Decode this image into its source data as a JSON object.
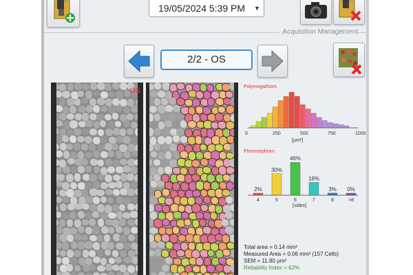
{
  "header": {
    "datetime": "19/05/2024 5:39 PM"
  },
  "section": {
    "title": "Acquisition Management"
  },
  "navigation": {
    "page_indicator": "2/2 - OS"
  },
  "image": {
    "eye_label": "OS"
  },
  "polymegathism": {
    "title": "Polymegathism",
    "unit": "[µm²]",
    "ticks": [
      "0",
      "250",
      "500",
      "750",
      "1000"
    ],
    "chart_data": {
      "type": "bar",
      "title": "Polymegathism",
      "xlabel": "[µm²]",
      "xlim": [
        0,
        1000
      ],
      "x": [
        50,
        100,
        150,
        200,
        250,
        300,
        350,
        400,
        450,
        500,
        550,
        600,
        650,
        700,
        750,
        800,
        850,
        900
      ],
      "values": [
        2,
        6,
        10,
        14,
        20,
        26,
        30,
        34,
        30,
        22,
        18,
        14,
        10,
        7,
        5,
        4,
        3,
        2
      ]
    }
  },
  "pleomorphism": {
    "title": "Pleomorphism",
    "unit": "[sides]",
    "chart_data": {
      "type": "bar",
      "title": "Pleomorphism",
      "xlabel": "[sides]",
      "categories": [
        "4",
        "5",
        "6",
        "7",
        "8",
        ">8"
      ],
      "values": [
        2,
        30,
        46,
        18,
        3,
        0
      ],
      "value_labels": [
        "2%",
        "30%",
        "46%",
        "18%",
        "3%",
        "0%"
      ],
      "colors": [
        "#e84b4b",
        "#f2cf3a",
        "#49c24a",
        "#35c6c0",
        "#3a6fd6",
        "#8a3fc9"
      ],
      "ylim": [
        0,
        50
      ]
    }
  },
  "stats": {
    "total_area": "Total area = 0.14 mm²",
    "measured_area": "Measured Area = 0.06 mm² (157 Cells)",
    "sem": "SEM = 11.80 µm²",
    "reliability": "Reliability Index = 62%"
  },
  "colors": {
    "accent": "#3b8fd0",
    "label_red": "#e8413a",
    "reliability_green": "#2f9a2f"
  },
  "icons": [
    "folder-add-icon",
    "camera-icon",
    "folder-delete-icon",
    "arrow-left-icon",
    "arrow-right-icon",
    "image-delete-icon"
  ]
}
